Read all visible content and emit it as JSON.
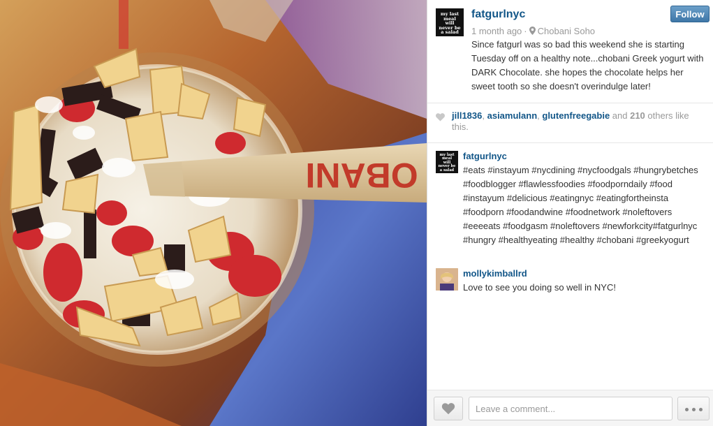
{
  "photo": {
    "description_icon": "photo-yogurt-cup",
    "spoon_text": "OBANI"
  },
  "post": {
    "username": "fatgurlnyc",
    "avatar_text": "my last meal will never be a salad",
    "time_ago": "1 month ago",
    "separator": "·",
    "location": "Chobani Soho",
    "caption": "Since fatgurl was so bad this weekend she is starting Tuesday off on a healthy note...chobani Greek yogurt with DARK Chocolate. she hopes the chocolate helps her sweet tooth so she doesn't overindulge later!",
    "follow_label": "Follow"
  },
  "likes": {
    "users": [
      "jill1836",
      "asiamulann",
      "glutenfreegabie"
    ],
    "comma": ", ",
    "and": " and ",
    "others_count": "210",
    "others_suffix": " others like this."
  },
  "comments": [
    {
      "username": "fatgurlnyc",
      "avatar_text": "my last meal will never be a salad",
      "text": "#eats #instayum #nycdining #nycfoodgals #hungrybetches #foodblogger #flawlessfoodies #foodporndaily #food #instayum #delicious #eatingnyc #eatingfortheinsta #foodporn #foodandwine #foodnetwork #noleftovers #eeeeats #foodgasm #noleftovers #newforkcity#fatgurlnyc #hungry #healthyeating #healthy #chobani #greekyogurt"
    },
    {
      "username": "mollykimballrd",
      "text": "Love to see you doing so well in NYC!"
    }
  ],
  "footer": {
    "comment_placeholder": "Leave a comment..."
  },
  "colors": {
    "link": "#125688",
    "follow": "#3f77a8",
    "muted": "#999999"
  }
}
